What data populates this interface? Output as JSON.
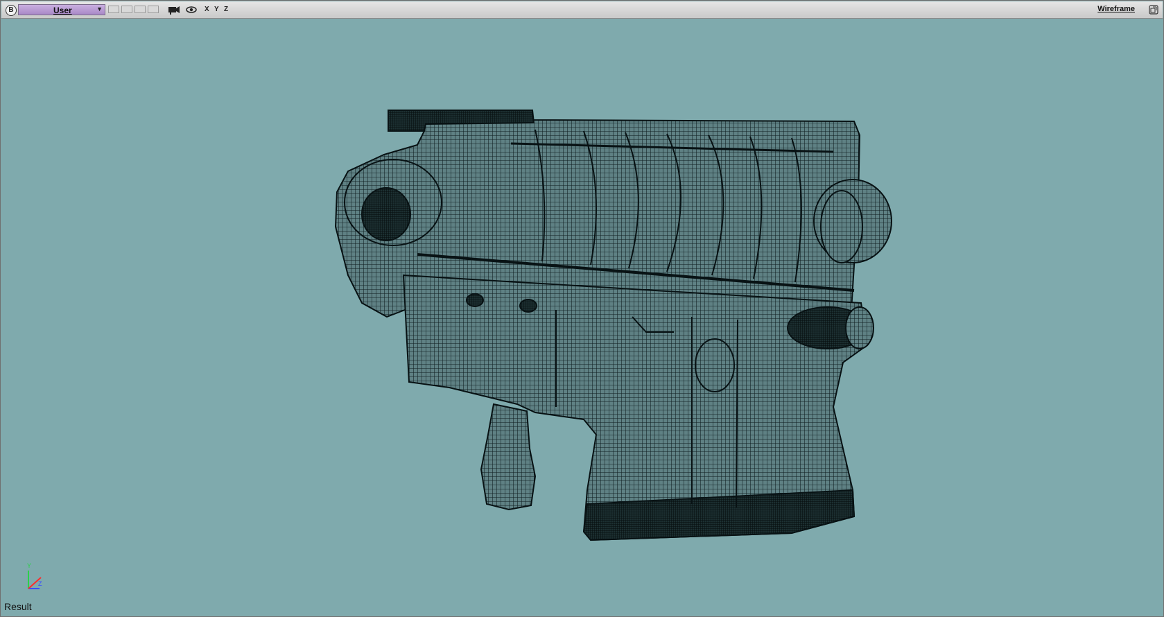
{
  "viewport": {
    "menu_badge": "B",
    "view_name": "User",
    "axes": [
      "X",
      "Y",
      "Z"
    ],
    "shading_prefix": "",
    "shading_underlined": "W",
    "shading_rest": "ireframe",
    "result_label": "Result",
    "background_color": "#7faaad",
    "wire_color": "#0f1d20"
  },
  "icons": [
    "camera-icon",
    "eye-icon",
    "maximize-icon",
    "axis-gizmo-icon"
  ],
  "gizmo": {
    "y": "Y",
    "z": "Z"
  }
}
